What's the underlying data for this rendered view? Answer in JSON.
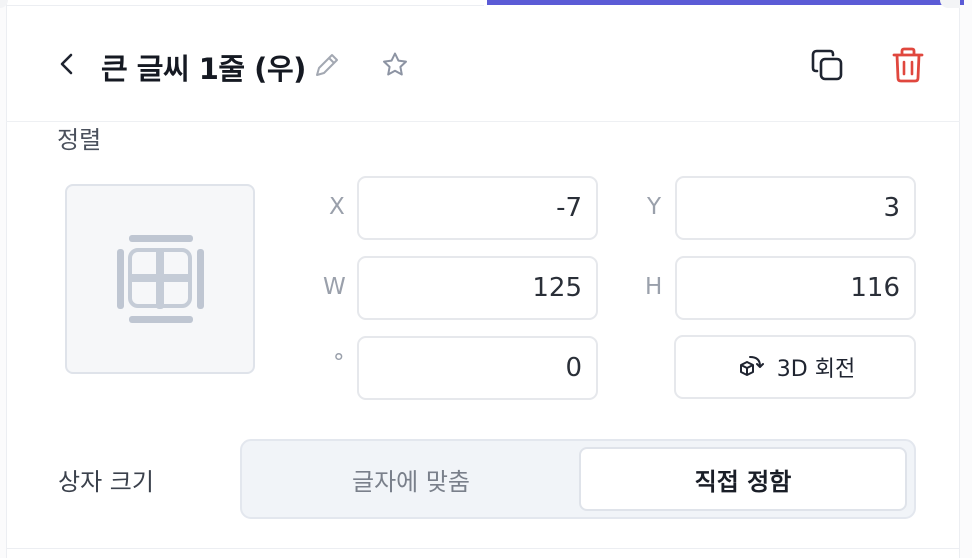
{
  "header": {
    "title": "큰 글씨 1줄 (우)",
    "icons": [
      "back-icon",
      "pencil-icon",
      "star-icon",
      "copy-icon",
      "trash-icon"
    ]
  },
  "alignment": {
    "label": "정렬",
    "icon": "align-grid-icon"
  },
  "transform": {
    "x": {
      "label": "X",
      "value": "-7"
    },
    "y": {
      "label": "Y",
      "value": "3"
    },
    "w": {
      "label": "W",
      "value": "125"
    },
    "h": {
      "label": "H",
      "value": "116"
    },
    "rotation": {
      "label": "°",
      "value": "0"
    },
    "rotate_3d_label": "3D 회전"
  },
  "box_size": {
    "label": "상자 크기",
    "options": [
      "글자에 맞춤",
      "직접 정함"
    ],
    "selected": "직접 정함"
  },
  "colors": {
    "accent": "#5b5bd6",
    "danger": "#e0473e"
  }
}
